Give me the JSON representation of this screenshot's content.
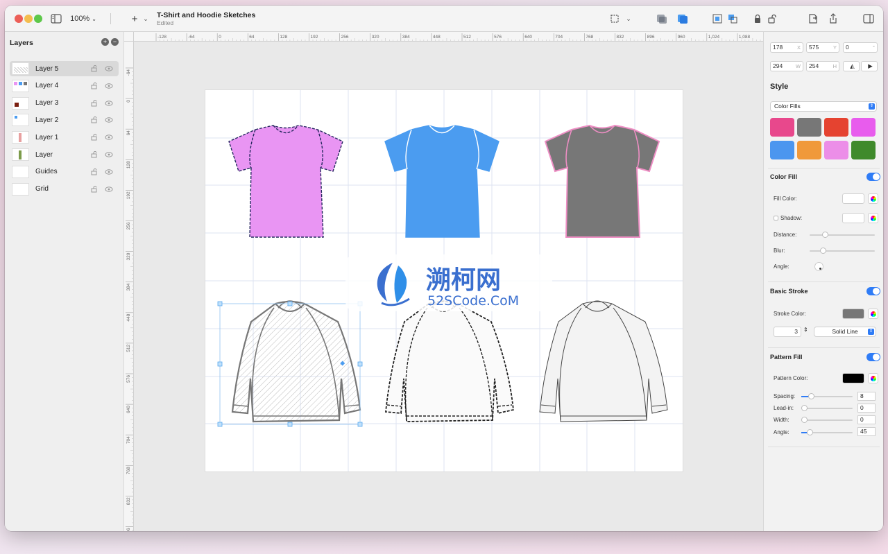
{
  "window": {
    "title": "T-Shirt and Hoodie Sketches",
    "subtitle": "Edited",
    "zoom": "100%"
  },
  "layers": {
    "header": "Layers",
    "items": [
      {
        "label": "Layer 5"
      },
      {
        "label": "Layer 4"
      },
      {
        "label": "Layer 3"
      },
      {
        "label": "Layer 2"
      },
      {
        "label": "Layer 1"
      },
      {
        "label": "Layer"
      },
      {
        "label": "Guides"
      },
      {
        "label": "Grid"
      }
    ]
  },
  "ruler_top": [
    "-128",
    "-64",
    "0",
    "64",
    "128",
    "192",
    "256",
    "320",
    "384",
    "448",
    "512",
    "576",
    "640",
    "704",
    "768",
    "832",
    "896",
    "960",
    "1,024",
    "1,088",
    "1,15"
  ],
  "ruler_left": [
    "-64",
    "0",
    "64",
    "128",
    "192",
    "256",
    "320",
    "384",
    "448",
    "512",
    "576",
    "640",
    "704",
    "768",
    "832",
    "896"
  ],
  "inspector": {
    "x": "178",
    "x_unit": "X",
    "y": "575",
    "y_unit": "Y",
    "rot": "0",
    "rot_unit": "°",
    "w": "294",
    "w_unit": "W",
    "h": "254",
    "h_unit": "H",
    "style_title": "Style",
    "style_select": "Color Fills",
    "swatches": [
      "#e8488c",
      "#777777",
      "#e54330",
      "#e85ced",
      "#4b96ef",
      "#f0993a",
      "#ec8ee8",
      "#3f8a2b"
    ],
    "color_fill": {
      "title": "Color Fill",
      "fill_color_label": "Fill Color:",
      "shadow_label": "Shadow:",
      "distance_label": "Distance:",
      "blur_label": "Blur:",
      "angle_label": "Angle:"
    },
    "basic_stroke": {
      "title": "Basic Stroke",
      "stroke_color_label": "Stroke Color:",
      "width_value": "3",
      "line_style": "Solid Line"
    },
    "pattern_fill": {
      "title": "Pattern Fill",
      "pattern_color_label": "Pattern Color:",
      "spacing_label": "Spacing:",
      "spacing_value": "8",
      "leadin_label": "Lead-in:",
      "leadin_value": "0",
      "width_label": "Width:",
      "width_value": "0",
      "angle_label": "Angle:",
      "angle_value": "45"
    }
  },
  "watermark": {
    "cn": "溯柯网",
    "en": "52SCode.CoM"
  }
}
